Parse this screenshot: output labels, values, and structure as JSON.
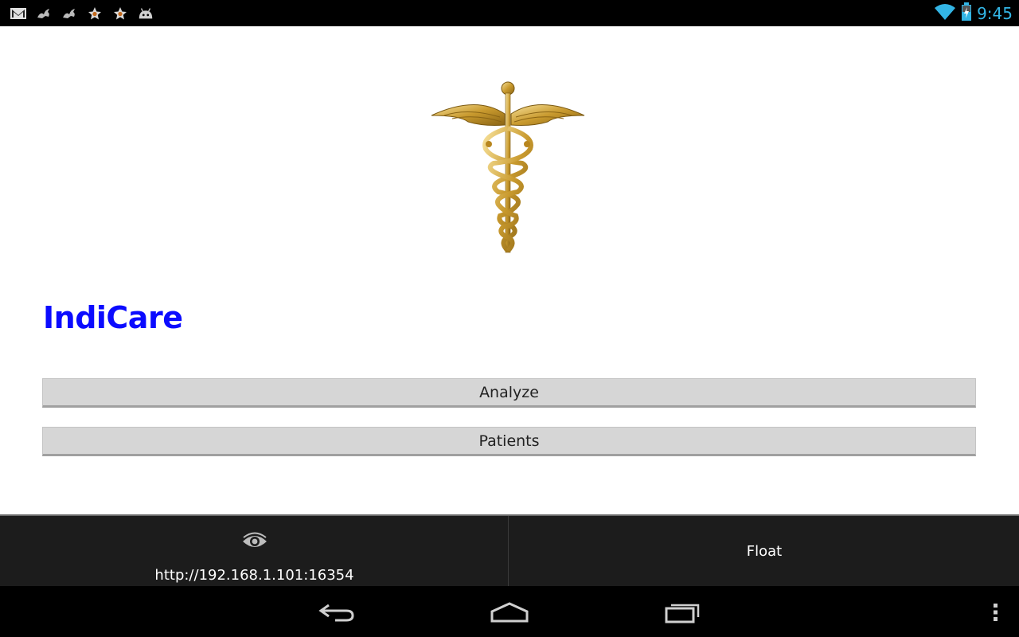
{
  "status_bar": {
    "time": "9:45",
    "left_icons": [
      "gmail-icon",
      "notification-bird-icon",
      "notification-bird-icon",
      "star-icon",
      "star-icon",
      "android-icon"
    ],
    "right_icons": [
      "wifi-icon",
      "battery-charging-icon"
    ],
    "clock_color": "#33b5e5"
  },
  "app": {
    "title": "IndiCare",
    "title_color": "#0b0bff",
    "logo_icon": "caduceus-icon",
    "buttons": {
      "analyze": "Analyze",
      "patients": "Patients"
    }
  },
  "overlay": {
    "viewer_icon": "eye-icon",
    "url": "http://192.168.1.101:16354",
    "float_label": "Float"
  },
  "nav_bar": {
    "icons": [
      "back-icon",
      "home-icon",
      "recent-apps-icon",
      "overflow-menu-icon"
    ]
  }
}
